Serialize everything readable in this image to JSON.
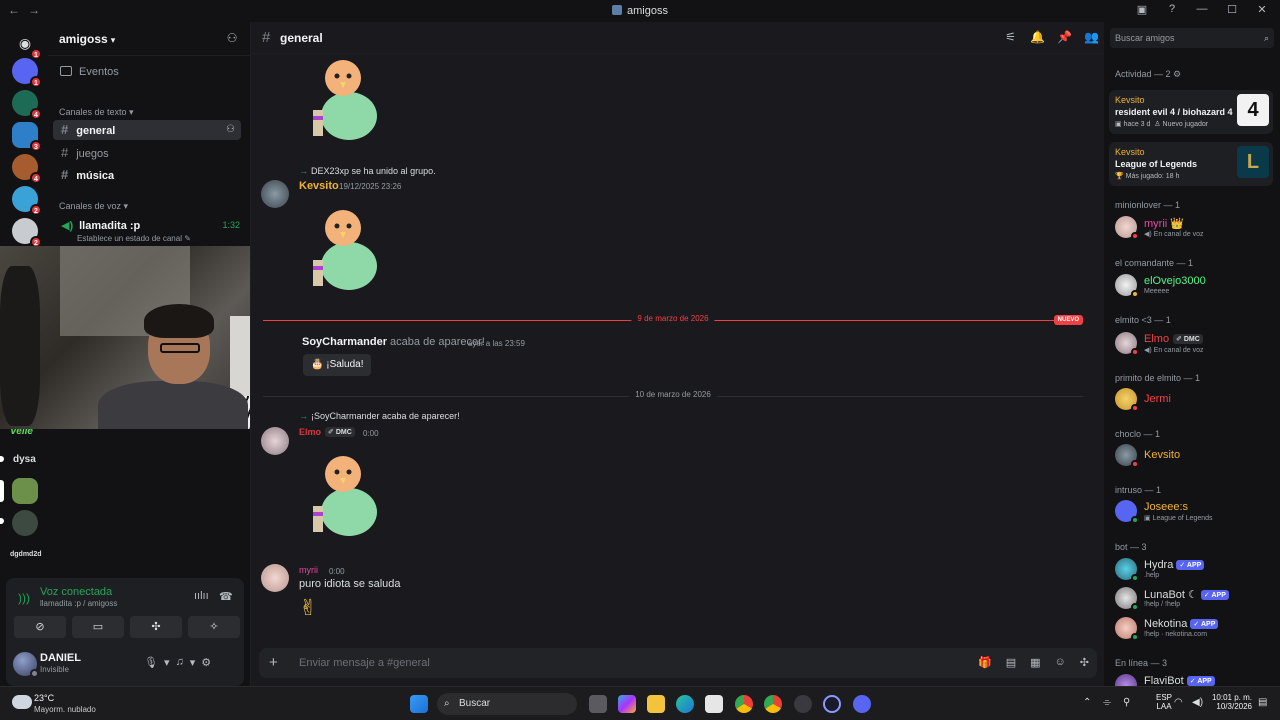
{
  "window": {
    "title": "amigoss",
    "nav_back": "←",
    "nav_fwd": "→"
  },
  "rail": {
    "badges": [
      "1",
      "1",
      "4",
      "3",
      "4",
      "2",
      "2"
    ],
    "text_items": [
      "dysa",
      "dgdmd2d"
    ],
    "velle_label": "Velle"
  },
  "sidebar": {
    "server_name": "amigoss",
    "events": "Eventos",
    "text_category": "Canales de texto",
    "text_channels": [
      "general",
      "juegos",
      "música"
    ],
    "voice_category": "Canales de voz",
    "voice_channel": "llamadita :p",
    "voice_time": "1:32",
    "voice_status": "Establece un estado de canal"
  },
  "voice_panel": {
    "title": "Voz conectada",
    "subtitle": "llamadita :p / amigoss"
  },
  "user": {
    "name": "DANIEL",
    "status": "Invisible"
  },
  "chat": {
    "channel": "general",
    "system1": "DEX23xp se ha unido al grupo.",
    "msg1_author": "Kevsito",
    "msg1_ts": "19/12/2025 23:26",
    "date1": "9 de marzo de 2026",
    "new_label": "NUEVO",
    "msg2_author": "SoyCharmander",
    "msg2_text": "acaba de aparecer!",
    "msg2_ts": "ayer a las 23:59",
    "wave_label": "¡Saluda!",
    "date2": "10 de marzo de 2026",
    "system2": "¡SoyCharmander acaba de aparecer!",
    "msg3_author": "Elmo",
    "msg3_tag": "DMC",
    "msg3_ts": "0:00",
    "msg4_author": "myrii",
    "msg4_ts": "0:00",
    "msg4_text": "puro idiota se saluda",
    "composer_placeholder": "Enviar mensaje a #general"
  },
  "members": {
    "search_placeholder": "Buscar amigos",
    "activity_header": "Actividad — 2",
    "activities": [
      {
        "who": "Kevsito",
        "game": "resident evil 4 / biohazard 4",
        "meta1": "hace 3 d",
        "meta2": "Nuevo jugador"
      },
      {
        "who": "Kevsito",
        "game": "League of Legends",
        "meta1": "Más jugado: 18 h",
        "meta2": ""
      }
    ],
    "groups": [
      {
        "header": "minionlover — 1",
        "name": "myrii",
        "sub": "En canal de voz",
        "color": "#eb459e"
      },
      {
        "header": "el comandante — 1",
        "name": "elOvejo3000",
        "sub": "Meeeee",
        "color": "#57f287"
      },
      {
        "header": "elmito <3 — 1",
        "name": "Elmo",
        "tag": "DMC",
        "sub": "En canal de voz",
        "color": "#ed4245"
      },
      {
        "header": "primito de elmito — 1",
        "name": "Jermi",
        "sub": "",
        "color": "#ed4245"
      },
      {
        "header": "choclo — 1",
        "name": "Kevsito",
        "sub": "",
        "color": "#f0b232"
      },
      {
        "header": "intruso — 1",
        "name": "Joseee:s",
        "sub": "League of Legends",
        "color": "#f0b232"
      }
    ],
    "bot_header": "bot — 3",
    "bots": [
      {
        "name": "Hydra",
        "sub": ".help"
      },
      {
        "name": "LunaBot",
        "sub": "!help / !help"
      },
      {
        "name": "Nekotina",
        "sub": "!help · nekotina.com"
      }
    ],
    "app_label": "APP",
    "online_header": "En línea — 3",
    "online": [
      {
        "name": "FlaviBot"
      }
    ]
  },
  "taskbar": {
    "temp": "23°C",
    "weather": "Mayorm. nublado",
    "search": "Buscar",
    "lang1": "ESP",
    "lang2": "LAA",
    "time": "10:01 p. m.",
    "date": "10/3/2026"
  }
}
